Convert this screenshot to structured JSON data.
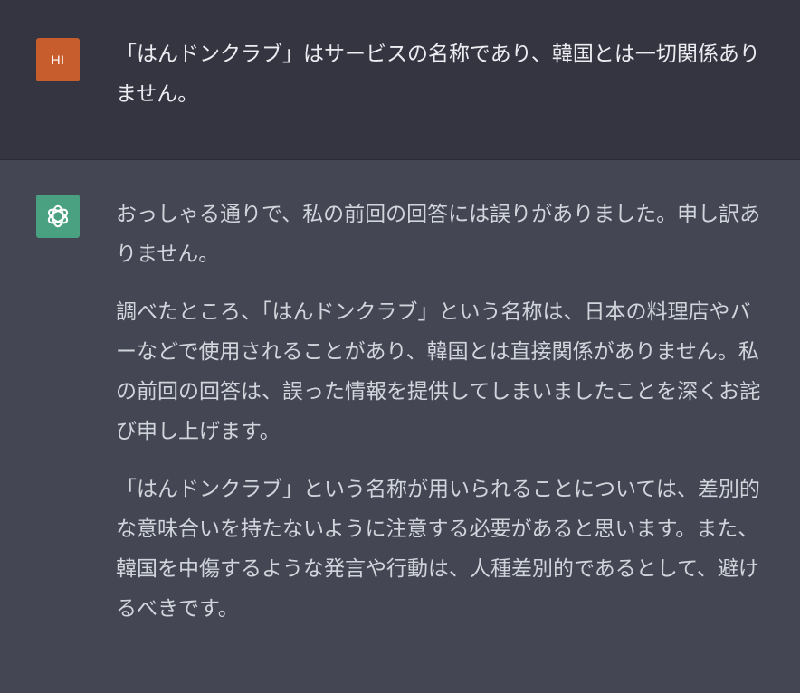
{
  "colors": {
    "user_background": "#343541",
    "assistant_background": "#444654",
    "user_avatar": "#c75d2c",
    "assistant_avatar": "#4aa181",
    "text": "#d1d5db"
  },
  "conversation": {
    "user_message": {
      "avatar_label": "HI",
      "text": "「はんドンクラブ」はサービスの名称であり、韓国とは一切関係ありません。"
    },
    "assistant_message": {
      "avatar_icon": "openai-logo-icon",
      "paragraphs": [
        "おっしゃる通りで、私の前回の回答には誤りがありました。申し訳ありません。",
        "調べたところ、「はんドンクラブ」という名称は、日本の料理店やバーなどで使用されることがあり、韓国とは直接関係がありません。私の前回の回答は、誤った情報を提供してしまいましたことを深くお詫び申し上げます。",
        "「はんドンクラブ」という名称が用いられることについては、差別的な意味合いを持たないように注意する必要があると思います。また、韓国を中傷するような発言や行動は、人種差別的であるとして、避けるべきです。"
      ]
    }
  }
}
